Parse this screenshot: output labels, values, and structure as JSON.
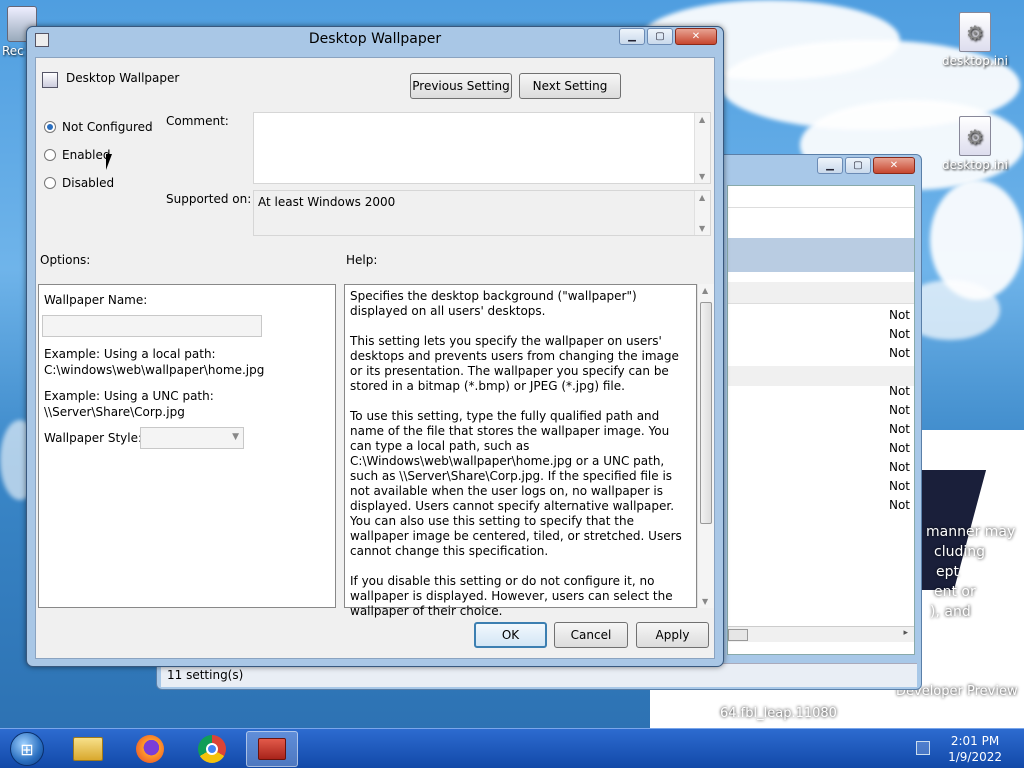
{
  "desktop": {
    "icons": [
      {
        "label": "desktop.ini"
      },
      {
        "label": "desktop.ini"
      }
    ],
    "partial_icon_label": "Rec",
    "overlay_lines": [
      "manner may",
      "cluding",
      "ept",
      "ent or",
      "), and",
      "Developer Preview",
      "64.fbl_leap.11080"
    ]
  },
  "back_window": {
    "rows": [
      "Not",
      "Not",
      "Not",
      "Not",
      "Not",
      "Not",
      "Not",
      "Not",
      "Not",
      "Not"
    ],
    "status": "11 setting(s)"
  },
  "dialog": {
    "title": "Desktop Wallpaper",
    "setting_name": "Desktop Wallpaper",
    "prev_button": "Previous Setting",
    "next_button": "Next Setting",
    "radios": [
      {
        "label": "Not Configured",
        "selected": true
      },
      {
        "label": "Enabled",
        "selected": false
      },
      {
        "label": "Disabled",
        "selected": false
      }
    ],
    "comment_label": "Comment:",
    "comment_value": "",
    "supported_label": "Supported on:",
    "supported_value": "At least Windows 2000",
    "options_label": "Options:",
    "help_label": "Help:",
    "options": {
      "wallpaper_name_label": "Wallpaper Name:",
      "wallpaper_name_value": "",
      "example_local_1": "Example: Using a local path:",
      "example_local_2": "C:\\windows\\web\\wallpaper\\home.jpg",
      "example_unc_1": "Example: Using a UNC path:",
      "example_unc_2": "\\\\Server\\Share\\Corp.jpg",
      "wallpaper_style_label": "Wallpaper Style:",
      "wallpaper_style_value": ""
    },
    "help_paragraphs": [
      "Specifies the desktop background (\"wallpaper\") displayed on all users' desktops.",
      "This setting lets you specify the wallpaper on users' desktops and prevents users from changing the image or its presentation. The wallpaper you specify can be stored in a bitmap (*.bmp) or JPEG (*.jpg) file.",
      "To use this setting, type the fully qualified path and name of the file that stores the wallpaper image. You can type a local path, such as C:\\Windows\\web\\wallpaper\\home.jpg or a UNC path, such as \\\\Server\\Share\\Corp.jpg. If the specified file is not available when the user logs on, no wallpaper is displayed. Users cannot specify alternative wallpaper. You can also use this setting to specify that the wallpaper image be centered, tiled, or stretched. Users cannot change this specification.",
      "If you disable this setting or do not configure it, no wallpaper is displayed. However, users can select the wallpaper of their choice."
    ],
    "ok_button": "OK",
    "cancel_button": "Cancel",
    "apply_button": "Apply"
  },
  "taskbar": {
    "time": "2:01 PM",
    "date": "1/9/2022",
    "apps": [
      "start-orb",
      "file-explorer",
      "firefox",
      "chrome",
      "group-policy-editor"
    ]
  },
  "colors": {
    "accent": "#3c7fb1",
    "taskbar": "#1d5bc0",
    "dialog_frame": "#a9c7e6"
  }
}
